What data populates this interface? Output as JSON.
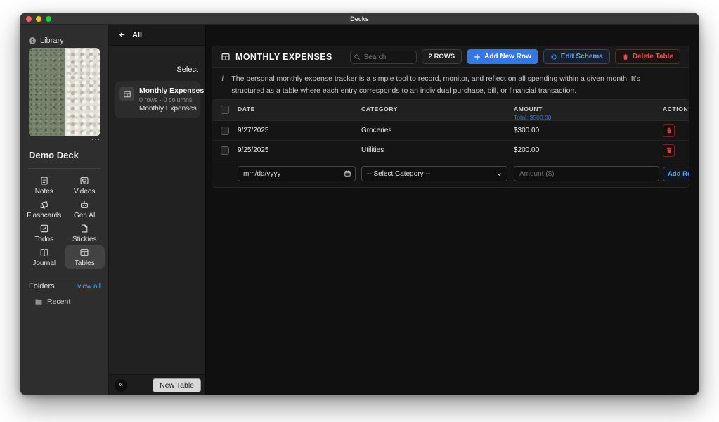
{
  "window": {
    "title": "Decks"
  },
  "colors": {
    "accent_blue": "#3578e5",
    "link_blue": "#4da3ff",
    "schema_blue": "#6ba1f0",
    "total_blue": "#3f6fd4",
    "danger_red": "#e05252",
    "traffic_red": "#ff5f57",
    "traffic_yellow": "#febc2e",
    "traffic_green": "#28c840"
  },
  "glyphs": {
    "ellipsis": "···",
    "collapse": "«"
  },
  "sidebar": {
    "library_label": "Library",
    "deck_title": "Demo Deck",
    "nav_items": [
      {
        "label": "Notes",
        "icon": "notes-icon"
      },
      {
        "label": "Videos",
        "icon": "videos-icon"
      },
      {
        "label": "Flashcards",
        "icon": "flashcards-icon"
      },
      {
        "label": "Gen AI",
        "icon": "robot-icon"
      },
      {
        "label": "Todos",
        "icon": "todos-icon"
      },
      {
        "label": "Stickies",
        "icon": "stickies-icon"
      },
      {
        "label": "Journal",
        "icon": "journal-icon"
      },
      {
        "label": "Tables",
        "icon": "tables-icon",
        "active": true
      }
    ],
    "folders_label": "Folders",
    "view_all_label": "view all",
    "folder_items": [
      {
        "label": "Recent"
      }
    ]
  },
  "list_panel": {
    "back_label": "All",
    "select_label": "Select",
    "cards": [
      {
        "title": "Monthly Expenses",
        "meta": "0 rows · 0 columns",
        "subtitle": "Monthly Expenses"
      }
    ],
    "new_table_label": "New Table"
  },
  "main": {
    "title": "MONTHLY EXPENSES",
    "search": {
      "placeholder": "Search..."
    },
    "rows_badge": "2 ROWS",
    "buttons": {
      "add_new_row": "Add New Row",
      "edit_schema": "Edit Schema",
      "delete_table": "Delete Table"
    },
    "description": "The personal monthly expense tracker is a simple tool to record, monitor, and reflect on all spending within a given month. It's structured as a table where each entry corresponds to an individual purchase, bill, or financial transaction.",
    "table": {
      "columns": {
        "date": "DATE",
        "category": "CATEGORY",
        "amount": "AMOUNT",
        "actions": "ACTIONS"
      },
      "amount_total": "Total: $500.00",
      "rows": [
        {
          "date": "9/27/2025",
          "category": "Groceries",
          "amount": "$300.00"
        },
        {
          "date": "9/25/2025",
          "category": "Utilities",
          "amount": "$200.00"
        }
      ]
    },
    "form": {
      "date_placeholder": "mm/dd/yyyy",
      "category_value": "-- Select Category --",
      "amount_placeholder": "Amount ($)",
      "add_row_label": "Add Row"
    }
  }
}
